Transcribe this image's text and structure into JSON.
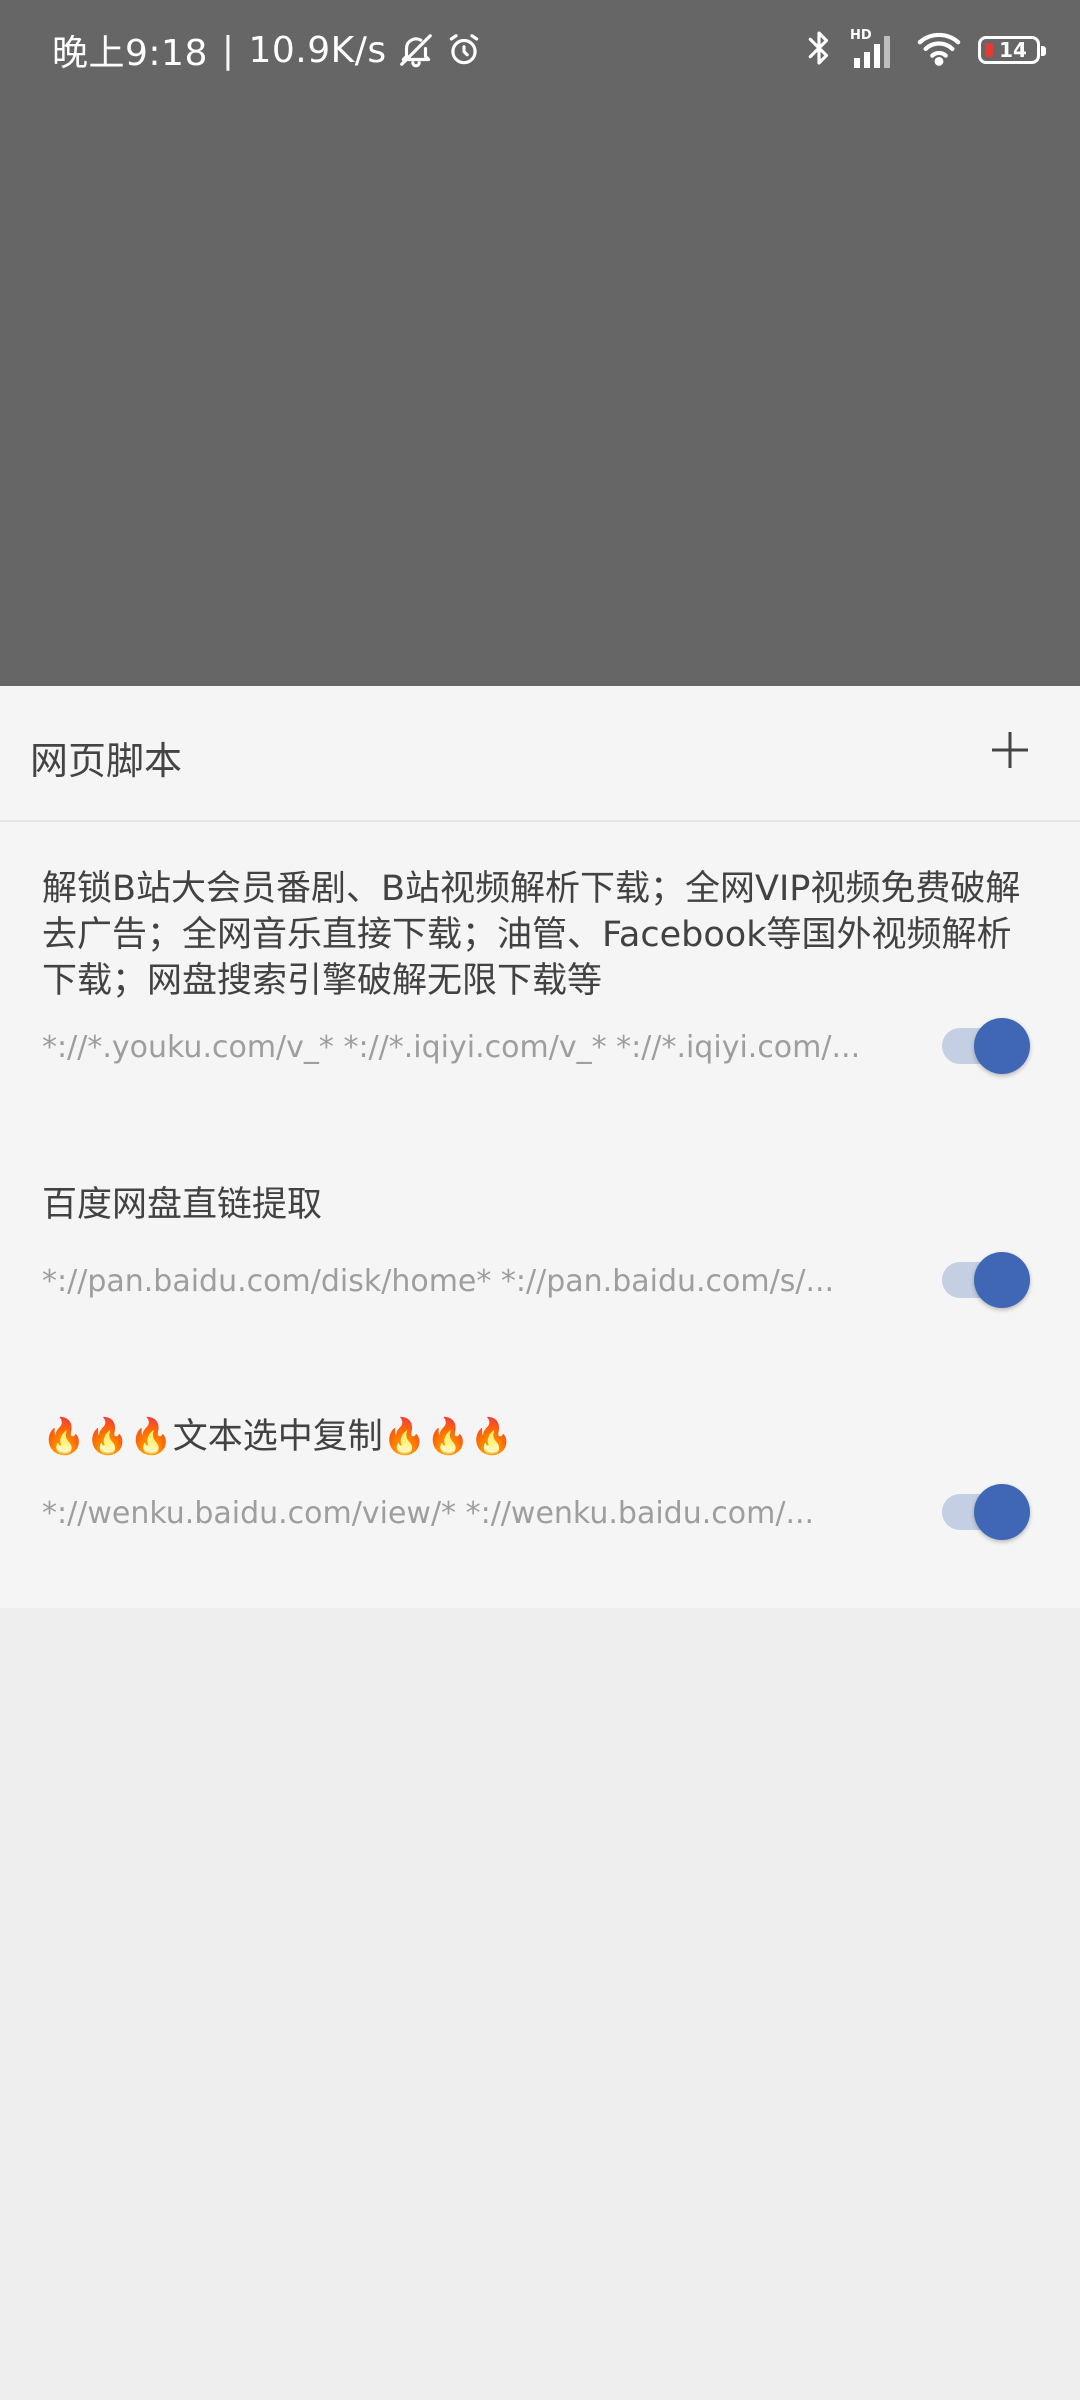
{
  "status_bar": {
    "time": "晚上9:18",
    "separator": "|",
    "network_speed": "10.9K/s",
    "icons_left": [
      "bell-off-icon",
      "alarm-icon"
    ],
    "icons_right": [
      "bluetooth-icon",
      "hd-signal-icon",
      "wifi-icon",
      "battery-icon"
    ],
    "battery_level": "14",
    "signal_label": "HD"
  },
  "sheet": {
    "title": "网页脚本",
    "add_icon": "plus-icon",
    "scripts": [
      {
        "title": "解锁B站大会员番剧、B站视频解析下载；全网VIP视频免费破解去广告；全网音乐直接下载；油管、Facebook等国外视频解析下载；网盘搜索引擎破解无限下载等",
        "urls": "*://*.youku.com/v_*  *://*.iqiyi.com/v_*  *://*.iqiyi.com/...",
        "enabled": true
      },
      {
        "title": "百度网盘直链提取",
        "urls": "*://pan.baidu.com/disk/home*  *://pan.baidu.com/s/...",
        "enabled": true
      },
      {
        "title": "🔥🔥🔥文本选中复制🔥🔥🔥",
        "urls": "*://wenku.baidu.com/view/*  *://wenku.baidu.com/...",
        "enabled": true
      }
    ]
  },
  "colors": {
    "accent": "#3f67b5",
    "track": "#c5cfe3",
    "backdrop": "#666666",
    "sheet": "#f5f5f5"
  }
}
